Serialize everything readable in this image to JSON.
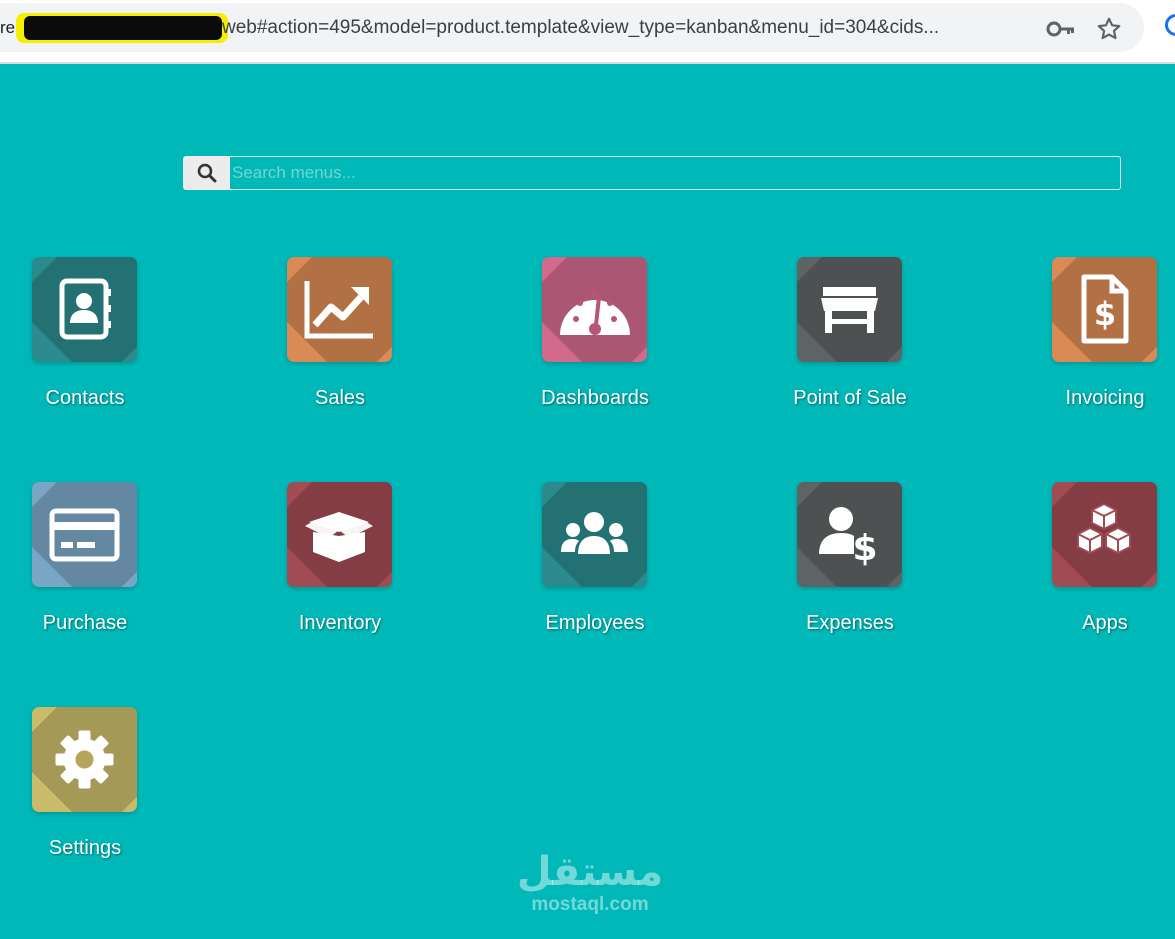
{
  "browser": {
    "url_prefix": "re",
    "url": "web#action=495&model=product.template&view_type=kanban&menu_id=304&cids..."
  },
  "search": {
    "placeholder": "Search menus..."
  },
  "apps": [
    {
      "label": "Contacts",
      "color": "#2b8a8d",
      "icon": "address-book-icon"
    },
    {
      "label": "Sales",
      "color": "#d98a55",
      "icon": "chart-line-icon"
    },
    {
      "label": "Dashboards",
      "color": "#d16a8c",
      "icon": "gauge-icon"
    },
    {
      "label": "Point of Sale",
      "color": "#5e6365",
      "icon": "store-icon"
    },
    {
      "label": "Invoicing",
      "color": "#d98a55",
      "icon": "invoice-dollar-icon"
    },
    {
      "label": "Purchase",
      "color": "#7aa6c6",
      "icon": "credit-card-icon"
    },
    {
      "label": "Inventory",
      "color": "#a14b53",
      "icon": "open-box-icon"
    },
    {
      "label": "Employees",
      "color": "#2b8a8d",
      "icon": "users-icon"
    },
    {
      "label": "Expenses",
      "color": "#5e6365",
      "icon": "user-dollar-icon"
    },
    {
      "label": "Apps",
      "color": "#a14b53",
      "icon": "cubes-icon"
    },
    {
      "label": "Settings",
      "color": "#c9bb69",
      "icon": "gear-icon"
    }
  ],
  "watermark": {
    "arabic": "مستقل",
    "latin": "mostaql.com"
  }
}
